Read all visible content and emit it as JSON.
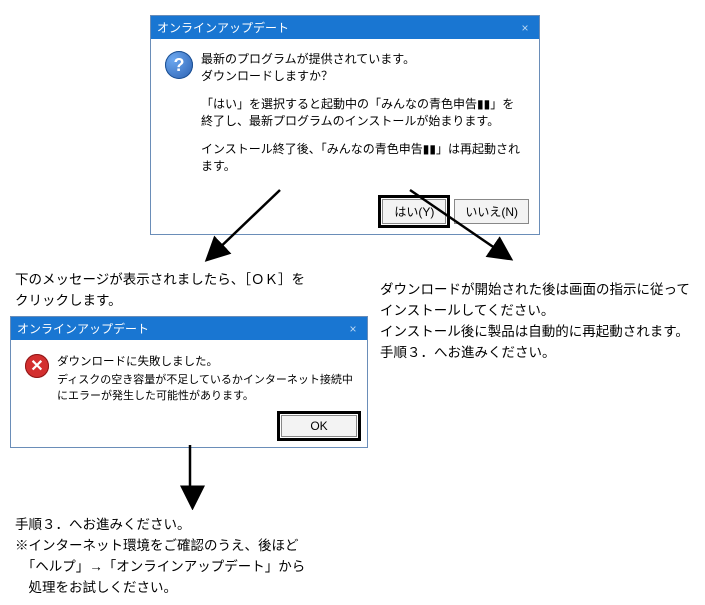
{
  "dialog1": {
    "title": "オンラインアップデート",
    "line1": "最新のプログラムが提供されています。",
    "line2": "ダウンロードしますか？",
    "line3": "「はい」を選択すると起動中の「みんなの青色申告▮▮」を終了し、最新プログラムのインストールが始まります。",
    "line4": "インストール終了後、「みんなの青色申告▮▮」は再起動されます。",
    "yes": "はい(Y)",
    "no": "いいえ(N)"
  },
  "leftCaption": "下のメッセージが表示されましたら、［ＯＫ］をクリックします。",
  "dialog2": {
    "title": "オンラインアップデート",
    "line1": "ダウンロードに失敗しました。",
    "line2": "ディスクの空き容量が不足しているかインターネット接続中にエラーが発生した可能性があります。",
    "ok": "OK"
  },
  "leftFooter": {
    "l1": "手順３．へお進みください。",
    "l2": "※インターネット環境をご確認のうえ、後ほど",
    "l3": "　「ヘルプ」→「オンラインアップデート」から",
    "l4": "　処理をお試しください。"
  },
  "rightBlock": {
    "l1": "ダウンロードが開始された後は画面の指示に従ってインストールしてください。",
    "l2": "インストール後に製品は自動的に再起動されます。",
    "l3": "手順３．へお進みください。"
  }
}
